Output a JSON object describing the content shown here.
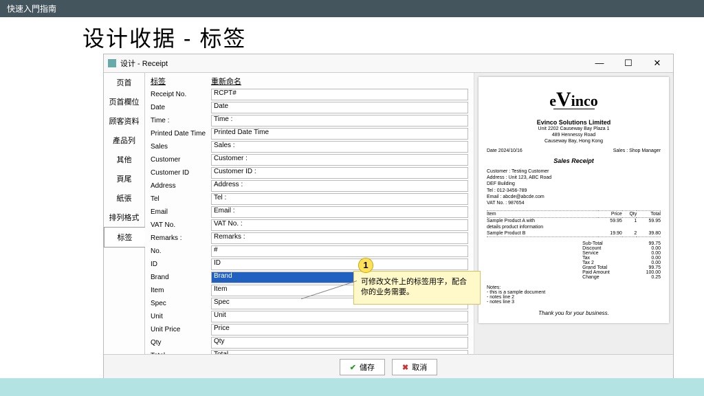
{
  "header": {
    "guide_title": "快速入門指南"
  },
  "page": {
    "title": "设计收据 - 标签"
  },
  "window": {
    "title": "设计 - Receipt",
    "sidebar_tabs": [
      "页首",
      "页首欄位",
      "顾客资料",
      "產品列",
      "其他",
      "頁尾",
      "紙張",
      "排列格式",
      "标签"
    ],
    "header_label": "标签",
    "header_rename": "重新命名",
    "rows": [
      {
        "label": "Receipt No.",
        "value": "RCPT#"
      },
      {
        "label": "Date",
        "value": "Date"
      },
      {
        "label": "Time :",
        "value": "Time :"
      },
      {
        "label": "Printed Date Time",
        "value": "Printed Date Time"
      },
      {
        "label": "Sales",
        "value": "Sales :"
      },
      {
        "label": "Customer",
        "value": "Customer :"
      },
      {
        "label": "Customer ID",
        "value": "Customer ID :"
      },
      {
        "label": "Address",
        "value": "Address :"
      },
      {
        "label": "Tel",
        "value": "Tel :"
      },
      {
        "label": "Email",
        "value": "Email :"
      },
      {
        "label": "VAT No.",
        "value": "VAT No. :"
      },
      {
        "label": "Remarks :",
        "value": "Remarks :"
      },
      {
        "label": "No.",
        "value": "#"
      },
      {
        "label": "ID",
        "value": "ID"
      },
      {
        "label": "Brand",
        "value": "Brand",
        "selected": true
      },
      {
        "label": "Item",
        "value": "Item"
      },
      {
        "label": "Spec",
        "value": "Spec"
      },
      {
        "label": "Unit",
        "value": "Unit"
      },
      {
        "label": "Unit Price",
        "value": "Price"
      },
      {
        "label": "Qty",
        "value": "Qty"
      },
      {
        "label": "Total",
        "value": "Total"
      }
    ],
    "save_label": "儲存",
    "cancel_label": "取消"
  },
  "callout": {
    "num": "1",
    "text": "可修改文件上的标签用字，配合你的业务需要。"
  },
  "receipt": {
    "logo_pre": "e",
    "logo_big": "V",
    "logo_post": "inco",
    "company": "Evinco Solutions Limited",
    "addr1": "Unit 2202 Causeway Bay Plaza 1",
    "addr2": "489 Hennessy Road",
    "addr3": "Causeway Bay, Hong Kong",
    "date": "Date 2024/10/16",
    "sales": "Sales : Shop Manager",
    "title": "Sales Receipt",
    "cust1": "Customer : Testing Customer",
    "cust2": "Address : Unit 123, ABC Road",
    "cust3": "DEF Building",
    "cust4": "Tel : 012-3456-789",
    "cust5": "Email : abcde@abcde.com",
    "cust6": "VAT No. : 987654",
    "h_item": "Item",
    "h_price": "Price",
    "h_qty": "Qty",
    "h_total": "Total",
    "r1_name": "Sample Product A with",
    "r1_sub": "details product information",
    "r1_price": "59.95",
    "r1_qty": "1",
    "r1_total": "59.95",
    "r2_name": "Sample Product B",
    "r2_price": "19.90",
    "r2_qty": "2",
    "r2_total": "39.80",
    "t_sub_l": "Sub-Total",
    "t_sub_v": "99.75",
    "t_disc_l": "Discount",
    "t_disc_v": "0.00",
    "t_serv_l": "Service",
    "t_serv_v": "0.00",
    "t_tax_l": "Tax",
    "t_tax_v": "0.00",
    "t_tax2_l": "Tax 2",
    "t_tax2_v": "0.00",
    "t_grand_l": "Grand Total",
    "t_grand_v": "99.75",
    "t_paid_l": "Paid Amount",
    "t_paid_v": "100.00",
    "t_change_l": "Change",
    "t_change_v": "0.25",
    "notes_h": "Notes:",
    "notes1": "- this is a sample document",
    "notes2": "- notes line 2",
    "notes3": "- notes line 3",
    "thanks": "Thank you for your business."
  }
}
